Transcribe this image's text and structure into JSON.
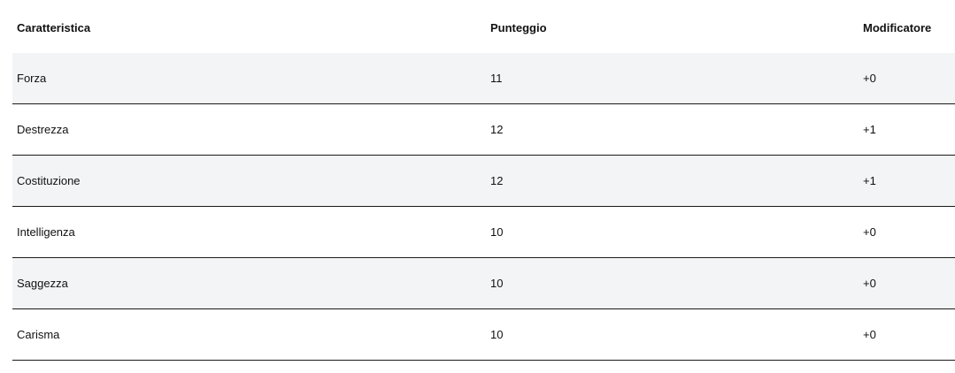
{
  "table": {
    "headers": {
      "name": "Caratteristica",
      "score": "Punteggio",
      "modifier": "Modificatore"
    },
    "rows": [
      {
        "name": "Forza",
        "score": "11",
        "modifier": "+0"
      },
      {
        "name": "Destrezza",
        "score": "12",
        "modifier": "+1"
      },
      {
        "name": "Costituzione",
        "score": "12",
        "modifier": "+1"
      },
      {
        "name": "Intelligenza",
        "score": "10",
        "modifier": "+0"
      },
      {
        "name": "Saggezza",
        "score": "10",
        "modifier": "+0"
      },
      {
        "name": "Carisma",
        "score": "10",
        "modifier": "+0"
      }
    ]
  }
}
